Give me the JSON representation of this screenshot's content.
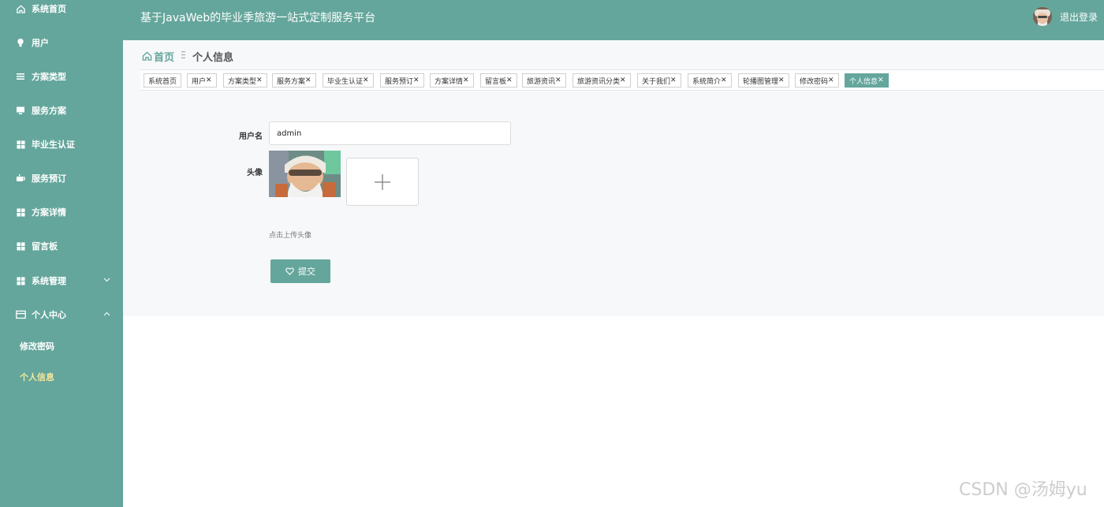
{
  "app": {
    "title": "基于JavaWeb的毕业季旅游一站式定制服务平台",
    "logout_label": "退出登录"
  },
  "colors": {
    "primary": "#64a69c",
    "active_submenu": "#f5e89a"
  },
  "sidebar": {
    "items": [
      {
        "label": "系统首页",
        "icon": "home-icon"
      },
      {
        "label": "用户",
        "icon": "bulb-icon"
      },
      {
        "label": "方案类型",
        "icon": "list-icon"
      },
      {
        "label": "服务方案",
        "icon": "monitor-icon"
      },
      {
        "label": "毕业生认证",
        "icon": "grid-icon"
      },
      {
        "label": "服务预订",
        "icon": "cup-icon"
      },
      {
        "label": "方案详情",
        "icon": "grid-icon"
      },
      {
        "label": "留言板",
        "icon": "grid-icon"
      },
      {
        "label": "系统管理",
        "icon": "grid-icon",
        "chevron": "chevron-down-icon"
      },
      {
        "label": "个人中心",
        "icon": "card-icon",
        "chevron": "chevron-up-icon"
      }
    ],
    "submenu": [
      {
        "label": "修改密码",
        "active": false
      },
      {
        "label": "个人信息",
        "active": true
      }
    ]
  },
  "breadcrumb": {
    "home": "首页",
    "current": "个人信息"
  },
  "tags": [
    {
      "label": "系统首页",
      "closable": false,
      "active": false
    },
    {
      "label": "用户",
      "closable": true,
      "active": false
    },
    {
      "label": "方案类型",
      "closable": true,
      "active": false
    },
    {
      "label": "服务方案",
      "closable": true,
      "active": false
    },
    {
      "label": "毕业生认证",
      "closable": true,
      "active": false
    },
    {
      "label": "服务预订",
      "closable": true,
      "active": false
    },
    {
      "label": "方案详情",
      "closable": true,
      "active": false
    },
    {
      "label": "留言板",
      "closable": true,
      "active": false
    },
    {
      "label": "旅游资讯",
      "closable": true,
      "active": false
    },
    {
      "label": "旅游资讯分类",
      "closable": true,
      "active": false
    },
    {
      "label": "关于我们",
      "closable": true,
      "active": false
    },
    {
      "label": "系统简介",
      "closable": true,
      "active": false
    },
    {
      "label": "轮播图管理",
      "closable": true,
      "active": false
    },
    {
      "label": "修改密码",
      "closable": true,
      "active": false
    },
    {
      "label": "个人信息",
      "closable": true,
      "active": true
    }
  ],
  "tag_close_glyph": "✕",
  "form": {
    "username_label": "用户名",
    "username_value": "admin",
    "avatar_label": "头像",
    "upload_hint": "点击上传头像",
    "submit_label": "提交"
  },
  "watermark": "CSDN @汤姆yu"
}
